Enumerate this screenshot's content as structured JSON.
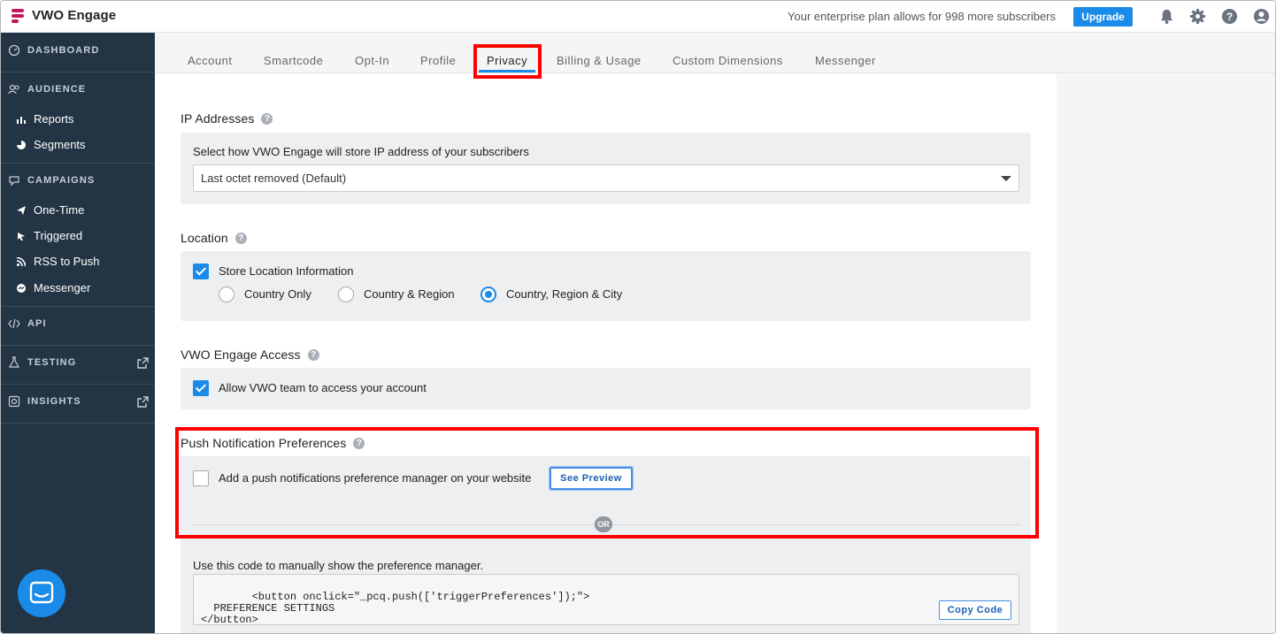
{
  "header": {
    "brand": "VWO Engage",
    "plan_text": "Your enterprise plan allows for 998 more subscribers",
    "upgrade_label": "Upgrade",
    "icons": [
      "bell-icon",
      "gear-icon",
      "help-icon",
      "user-icon"
    ]
  },
  "sidebar": {
    "sections": {
      "dashboard": "DASHBOARD",
      "audience": "AUDIENCE",
      "campaigns": "CAMPAIGNS",
      "api": "API",
      "testing": "TESTING",
      "insights": "INSIGHTS"
    },
    "audience_items": [
      "Reports",
      "Segments"
    ],
    "campaign_items": [
      "One-Time",
      "Triggered",
      "RSS to Push",
      "Messenger"
    ]
  },
  "tabs": [
    "Account",
    "Smartcode",
    "Opt-In",
    "Profile",
    "Privacy",
    "Billing & Usage",
    "Custom Dimensions",
    "Messenger"
  ],
  "active_tab": "Privacy",
  "ip": {
    "title": "IP Addresses",
    "label": "Select how VWO Engage will store IP address of your subscribers",
    "selected": "Last octet removed (Default)"
  },
  "location": {
    "title": "Location",
    "store_label": "Store Location Information",
    "store_checked": true,
    "options": [
      "Country Only",
      "Country & Region",
      "Country, Region & City"
    ],
    "selected_option": "Country, Region & City"
  },
  "access": {
    "title": "VWO Engage Access",
    "allow_label": "Allow VWO team to access your account",
    "allow_checked": true
  },
  "push": {
    "title": "Push Notification Preferences",
    "manager_label": "Add a push notifications preference manager on your website",
    "manager_checked": false,
    "preview_label": "See Preview",
    "or_label": "OR",
    "code_label": "Use this code to manually show the preference manager.",
    "code": "<button onclick=\"_pcq.push(['triggerPreferences']);\">\n  PREFERENCE SETTINGS\n</button>",
    "copy_label": "Copy Code"
  },
  "colors": {
    "accent": "#1a8be8",
    "sidebar_bg": "#233545",
    "brand": "#c2185b",
    "highlight": "#ff0000"
  }
}
